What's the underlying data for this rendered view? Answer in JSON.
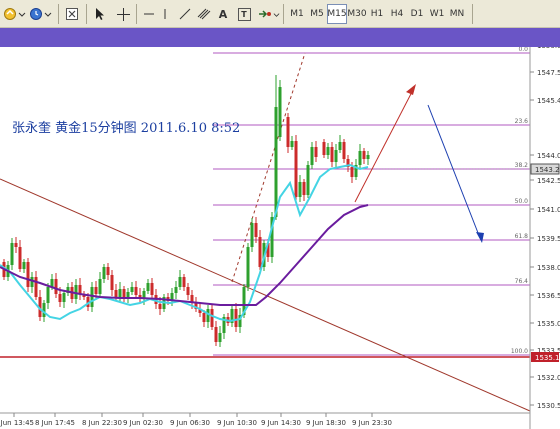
{
  "toolbar": {
    "timeframes": [
      "M1",
      "M5",
      "M15",
      "M30",
      "H1",
      "H4",
      "D1",
      "W1",
      "MN"
    ],
    "active_timeframe": "M15",
    "tools": [
      "new-order-icon",
      "clock-icon",
      "close-window-icon",
      "cursor-icon",
      "crosshair-icon",
      "hline-icon",
      "vline-icon",
      "trendline-icon",
      "text-icon",
      "label-icon",
      "arrow-icon"
    ],
    "text_tool_label": "A",
    "label_tool_label": "T"
  },
  "chart": {
    "annotation_title": "张永奎  黄金15分钟图  2011.6.10 8:52",
    "current_price": "1543.2",
    "support_price": "1535.1",
    "price_ticks": [
      "1550.0",
      "1547.5",
      "1545.4",
      "1544.0",
      "1542.5",
      "1541.0",
      "1539.5",
      "1538.0",
      "1536.5",
      "1535.0",
      "1533.5",
      "1532.0",
      "1530.5"
    ],
    "time_ticks": [
      "7 Jun 13:45",
      "8 Jun 17:45",
      "8 Jun 22:30",
      "9 Jun 02:30",
      "9 Jun 06:30",
      "9 Jun 10:30",
      "9 Jun 14:30",
      "9 Jun 18:30",
      "9 Jun 23:30"
    ],
    "fib_levels": [
      "0.0",
      "23.6",
      "38.2",
      "50.0",
      "61.8",
      "76.4",
      "100.0"
    ],
    "colors": {
      "bull": "#2ea02e",
      "bear": "#cc2b2b",
      "ma_fast": "#44d4e4",
      "ma_slow": "#6a1c9e",
      "fib": "#b05ac0",
      "support": "#c0202a",
      "trend": "#a0382c",
      "arrow_up": "#c0302a",
      "arrow_down": "#1c3fb0"
    }
  }
}
